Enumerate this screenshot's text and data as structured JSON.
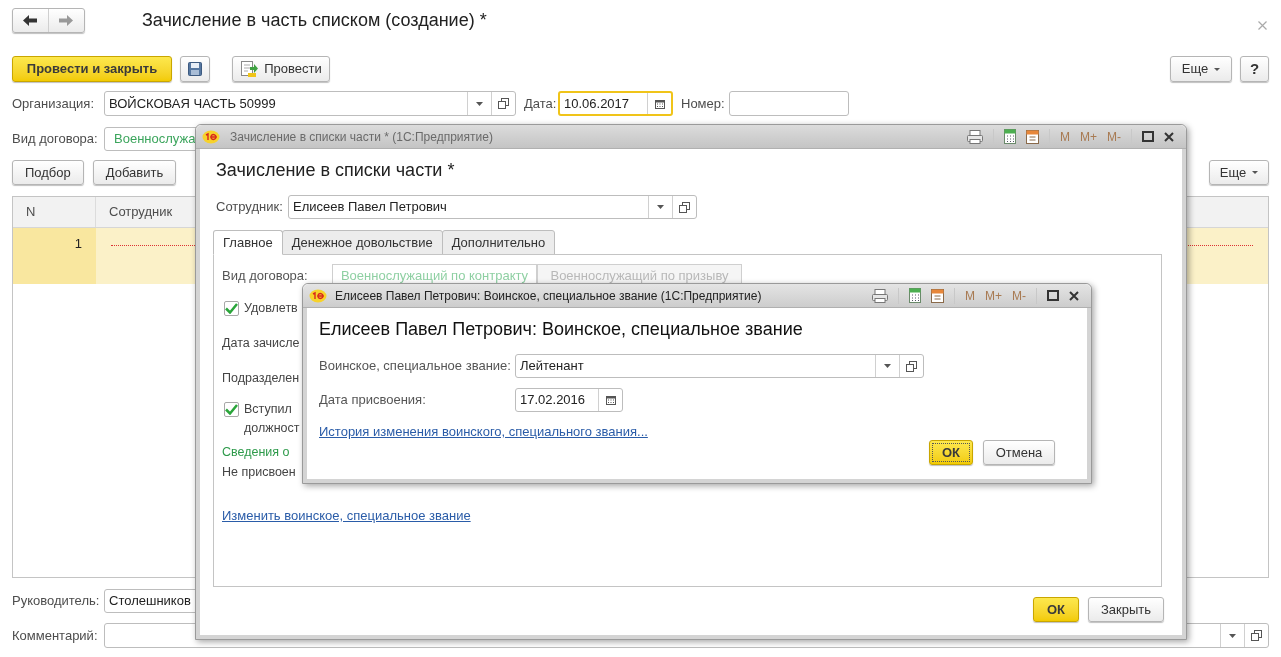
{
  "main": {
    "title": "Зачисление в часть списком (создание) *",
    "buttons": {
      "post_and_close": "Провести и закрыть",
      "post": "Провести",
      "more": "Еще",
      "help": "?"
    },
    "organization": {
      "label": "Организация:",
      "value": "ВОЙСКОВАЯ ЧАСТЬ 50999"
    },
    "date": {
      "label": "Дата:",
      "value": "10.06.2017",
      "focused": true
    },
    "number": {
      "label": "Номер:"
    },
    "contract_type": {
      "label": "Вид договора:",
      "value": "Военнослужа"
    },
    "table_buttons": [
      "Подбор",
      "Добавить"
    ],
    "table_more": "Еще",
    "table": {
      "columns": [
        "N",
        "Сотрудник"
      ],
      "rows": [
        {
          "n": "1",
          "selected": true
        }
      ]
    },
    "manager": {
      "label": "Руководитель:",
      "value": "Столешников"
    },
    "comment": {
      "label": "Комментарий:"
    }
  },
  "dialog": {
    "window_title": "Зачисление в списки части * (1С:Предприятие)",
    "tools": [
      {
        "label": "M",
        "disabled": true
      },
      {
        "label": "M+",
        "disabled": true
      },
      {
        "label": "M-",
        "disabled": true
      }
    ],
    "heading": "Зачисление в списки части *",
    "employee": {
      "label": "Сотрудник:",
      "value": "Елисеев Павел Петрович"
    },
    "tabs": [
      {
        "label": "Главное",
        "selected": true
      },
      {
        "label": "Денежное довольствие",
        "selected": false
      },
      {
        "label": "Дополнительно",
        "selected": false
      }
    ],
    "contract_type": {
      "label": "Вид договора:",
      "options": [
        {
          "label": "Военнослужащий по контракту",
          "selected": true
        },
        {
          "label": "Военнослужащий по призыву",
          "selected": false
        }
      ]
    },
    "fields": [
      {
        "kind": "checkbox",
        "lines": [
          "Удовлетв"
        ],
        "checked": true
      },
      {
        "kind": "label",
        "text": "Дата зачисле"
      },
      {
        "kind": "label",
        "text": "Подразделен"
      },
      {
        "kind": "checkbox",
        "lines": [
          "Вступил",
          "должност"
        ],
        "checked": true
      },
      {
        "kind": "section",
        "text": "Сведения о"
      },
      {
        "kind": "label",
        "text": "Не присвоен"
      },
      {
        "kind": "link",
        "text": "Изменить воинское, специальное звание"
      }
    ],
    "buttons": {
      "ok": "ОК",
      "close": "Закрыть"
    }
  },
  "subdialog": {
    "window_title": "Елисеев Павел Петрович: Воинское, специальное звание (1С:Предприятие)",
    "tools": [
      {
        "label": "M",
        "disabled": true
      },
      {
        "label": "M+",
        "disabled": true
      },
      {
        "label": "M-",
        "disabled": true
      }
    ],
    "heading": "Елисеев Павел Петрович: Воинское, специальное звание",
    "rank": {
      "label": "Воинское, специальное звание:",
      "value": "Лейтенант"
    },
    "date": {
      "label": "Дата присвоения:",
      "value": "17.02.2016"
    },
    "history_link": "История изменения воинского, специального звания...",
    "buttons": {
      "ok": "ОК",
      "cancel": "Отмена"
    },
    "ok_focused": true
  }
}
